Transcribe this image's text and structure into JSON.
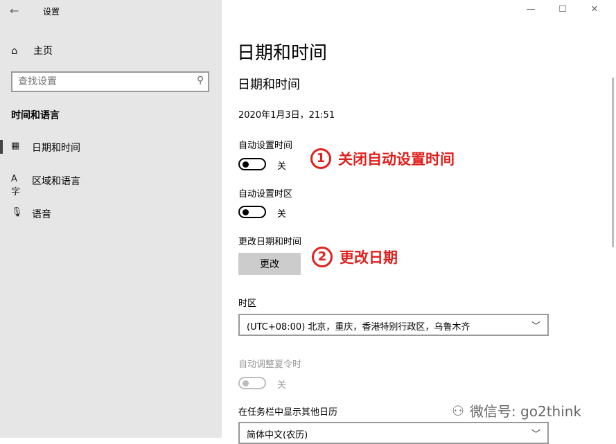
{
  "window": {
    "title": "设置",
    "controls": [
      "—",
      "☐",
      "✕"
    ]
  },
  "sidebar": {
    "home_label": "主页",
    "search_placeholder": "查找设置",
    "section_title": "时间和语言",
    "items": [
      {
        "label": "日期和时间",
        "icon": "calendar-clock-icon",
        "active": true
      },
      {
        "label": "区域和语言",
        "icon": "language-icon",
        "active": false
      },
      {
        "label": "语音",
        "icon": "microphone-icon",
        "active": false
      }
    ]
  },
  "main": {
    "page_title": "日期和时间",
    "section_title": "日期和时间",
    "current_datetime": "2020年1月3日，21:51",
    "auto_time": {
      "label": "自动设置时间",
      "state": "关"
    },
    "auto_timezone": {
      "label": "自动设置时区",
      "state": "关"
    },
    "change": {
      "label": "更改日期和时间",
      "button": "更改"
    },
    "timezone": {
      "label": "时区",
      "value": "(UTC+08:00) 北京，重庆，香港特别行政区，乌鲁木齐"
    },
    "dst": {
      "label": "自动调整夏令时",
      "state": "关"
    },
    "calendar": {
      "label": "在任务栏中显示其他日历",
      "value": "简体中文(农历)"
    }
  },
  "annotations": [
    {
      "num": "1",
      "text": "关闭自动设置时间"
    },
    {
      "num": "2",
      "text": "更改日期"
    }
  ],
  "watermark": {
    "text": "微信号: go2think"
  },
  "colors": {
    "accent_annotation": "#e0201c",
    "sidebar_bg": "#e6e6e6"
  }
}
